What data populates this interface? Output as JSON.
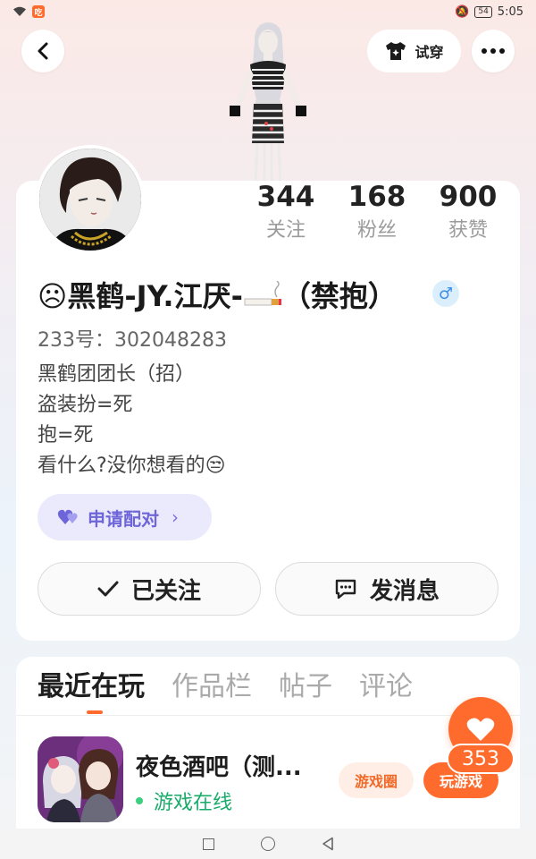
{
  "status_bar": {
    "time": "5:05",
    "battery": "54",
    "app_badge": "吃"
  },
  "header": {
    "tryon_label": "试穿"
  },
  "stats": [
    {
      "count": "344",
      "label": "关注"
    },
    {
      "count": "168",
      "label": "粉丝"
    },
    {
      "count": "900",
      "label": "获赞"
    }
  ],
  "profile": {
    "nickname_prefix": "☹黑鹤-JY.江厌-",
    "nickname_suffix": "（禁抱）",
    "gender_symbol": "♂",
    "uid": "233号：302048283",
    "bio_lines": [
      "黑鹤团团长（招）",
      "盗装扮=死",
      "抱=死",
      "看什么?没你想看的😒"
    ],
    "pair_label": "申请配对",
    "follow_label": "已关注",
    "message_label": "发消息"
  },
  "tabs": [
    {
      "label": "最近在玩"
    },
    {
      "label": "作品栏"
    },
    {
      "label": "帖子"
    },
    {
      "label": "评论"
    }
  ],
  "recent_game": {
    "title": "夜色酒吧（测...",
    "status": "游戏在线",
    "circle_label": "游戏圈",
    "play_label": "玩游戏"
  },
  "like": {
    "count": "353"
  },
  "colors": {
    "accent": "#ff6b2c",
    "pair": "#6e66d8",
    "online": "#1aab6a"
  }
}
